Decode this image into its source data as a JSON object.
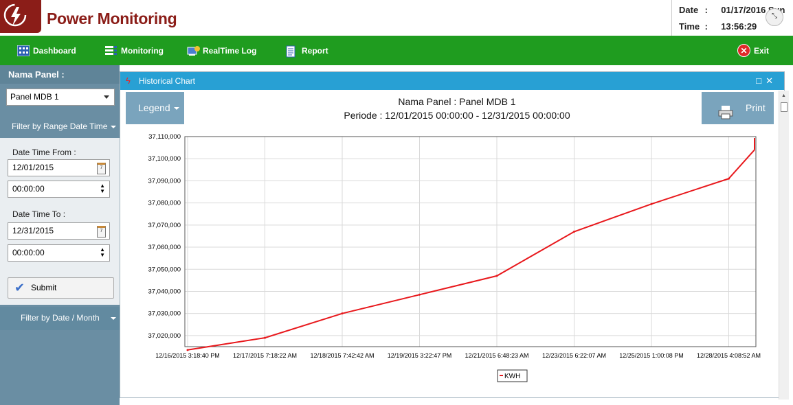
{
  "app": {
    "title": "Power Monitoring"
  },
  "datetime": {
    "date_label": "Date",
    "date_value": "01/17/2016 Sun",
    "time_label": "Time",
    "time_value": "13:56:29",
    "separator": ":"
  },
  "nav": {
    "items": [
      {
        "label": "Dashboard",
        "icon": "dashboard-icon"
      },
      {
        "label": "Monitoring",
        "icon": "monitoring-icon"
      },
      {
        "label": "RealTime Log",
        "icon": "realtime-log-icon"
      },
      {
        "label": "Report",
        "icon": "report-icon"
      }
    ],
    "exit_label": "Exit"
  },
  "sidebar": {
    "panel_heading": "Nama Panel :",
    "panel_selected": "Panel MDB 1",
    "filter_range_label": "Filter by Range Date Time",
    "date_from_label": "Date Time From :",
    "date_from_value": "12/01/2015",
    "time_from_value": "00:00:00",
    "date_to_label": "Date Time To :",
    "date_to_value": "12/31/2015",
    "time_to_value": "00:00:00",
    "submit_label": "Submit",
    "filter_month_label": "Filter by Date / Month"
  },
  "window": {
    "title": "Historical Chart",
    "legend_label": "Legend",
    "print_label": "Print",
    "chart_title_line1": "Nama Panel : Panel MDB 1",
    "chart_title_line2": "Periode : 12/01/2015 00:00:00 - 12/31/2015 00:00:00"
  },
  "colors": {
    "nav_green": "#1f9c1f",
    "title_red": "#8b1d18",
    "panel_blue": "#28a0d4",
    "series_red": "#e8181c"
  },
  "chart_data": {
    "type": "line",
    "title": "Nama Panel : Panel MDB 1",
    "subtitle": "Periode : 12/01/2015 00:00:00 - 12/31/2015 00:00:00",
    "xlabel": "",
    "ylabel": "",
    "x_tick_labels": [
      "12/16/2015 3:18:40 PM",
      "12/17/2015 7:18:22 AM",
      "12/18/2015 7:42:42 AM",
      "12/19/2015 3:22:47 PM",
      "12/21/2015 6:48:23 AM",
      "12/23/2015 6:22:07 AM",
      "12/25/2015 1:00:08 PM",
      "12/28/2015 4:08:52 AM"
    ],
    "y_tick_labels": [
      "37,020,000",
      "37,030,000",
      "37,040,000",
      "37,050,000",
      "37,060,000",
      "37,070,000",
      "37,080,000",
      "37,090,000",
      "37,100,000",
      "37,110,000"
    ],
    "ylim": [
      37015000,
      37110000
    ],
    "grid": true,
    "legend": "bottom-center",
    "series": [
      {
        "name": "KWH",
        "color": "#e8181c",
        "x": [
          "12/16/2015 3:18:40 PM",
          "12/17/2015 7:18:22 AM",
          "12/18/2015 7:42:42 AM",
          "12/19/2015 3:22:47 PM",
          "12/21/2015 6:48:23 AM",
          "12/23/2015 6:22:07 AM",
          "12/25/2015 1:00:08 PM",
          "12/28/2015 4:08:52 AM"
        ],
        "values": [
          37013500,
          37019000,
          37030000,
          37038500,
          37047000,
          37067000,
          37079500,
          37091000
        ],
        "end_value": 37104000
      }
    ]
  }
}
